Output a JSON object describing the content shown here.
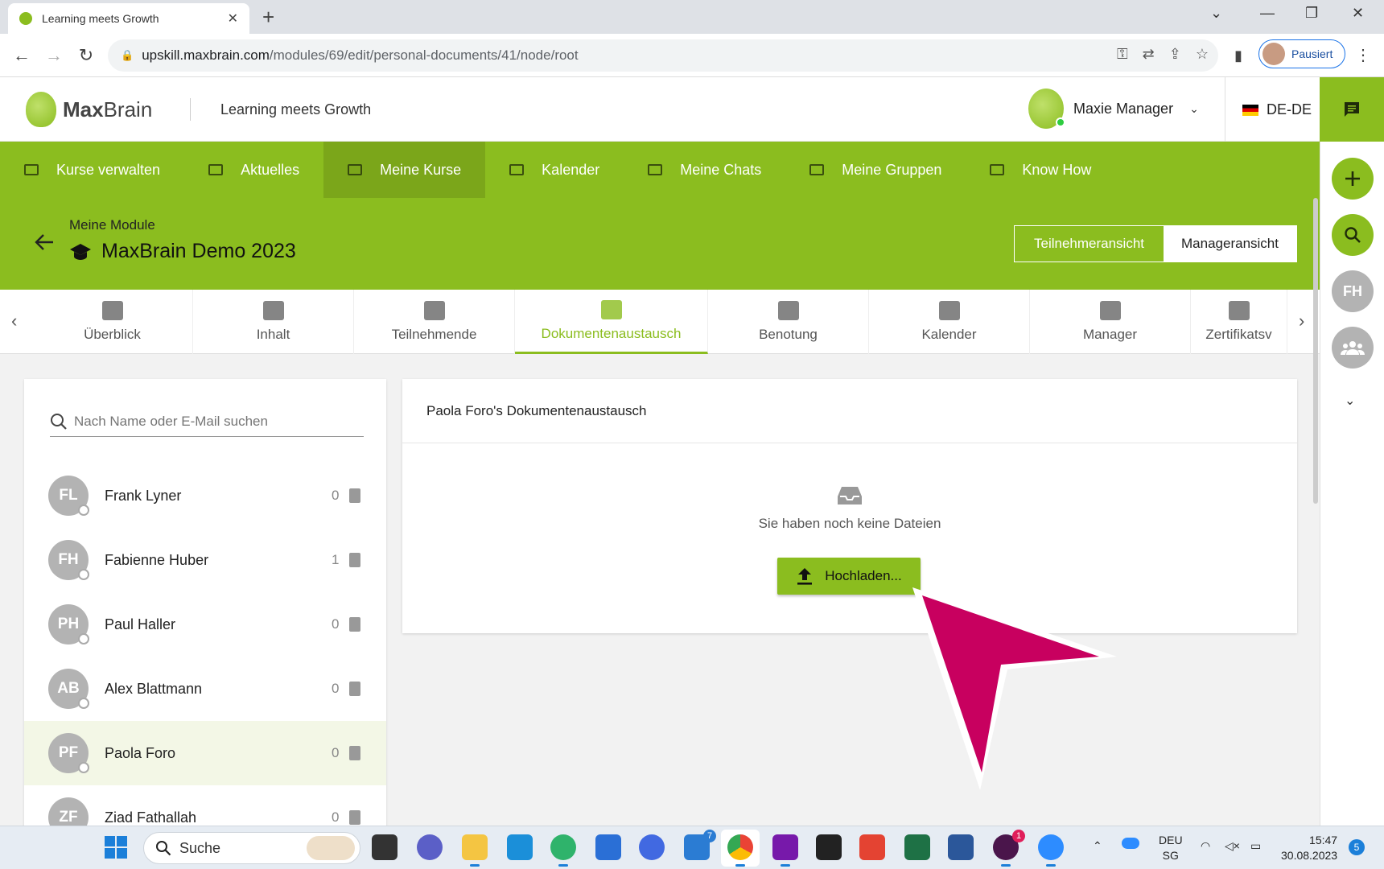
{
  "browser": {
    "tab_title": "Learning meets Growth",
    "url_host": "upskill.maxbrain.com",
    "url_path": "/modules/69/edit/personal-documents/41/node/root",
    "profile_label": "Pausiert"
  },
  "header": {
    "logo_bold": "Max",
    "logo_light": "Brain",
    "tagline": "Learning meets Growth",
    "user_name": "Maxie Manager",
    "language": "DE-DE"
  },
  "main_nav": [
    {
      "label": "Kurse verwalten"
    },
    {
      "label": "Aktuelles"
    },
    {
      "label": "Meine Kurse"
    },
    {
      "label": "Kalender"
    },
    {
      "label": "Meine Chats"
    },
    {
      "label": "Meine Gruppen"
    },
    {
      "label": "Know How"
    }
  ],
  "module": {
    "breadcrumb": "Meine Module",
    "title": "MaxBrain Demo 2023",
    "view_participant": "Teilnehmeransicht",
    "view_manager": "Manageransicht"
  },
  "sub_tabs": [
    {
      "label": "Überblick"
    },
    {
      "label": "Inhalt"
    },
    {
      "label": "Teilnehmende"
    },
    {
      "label": "Dokumentenaustausch"
    },
    {
      "label": "Benotung"
    },
    {
      "label": "Kalender"
    },
    {
      "label": "Manager"
    },
    {
      "label": "Zertifikatsv"
    }
  ],
  "participants": {
    "search_placeholder": "Nach Name oder E-Mail suchen",
    "rows": [
      {
        "initials": "FL",
        "name": "Frank Lyner",
        "count": "0"
      },
      {
        "initials": "FH",
        "name": "Fabienne Huber",
        "count": "1"
      },
      {
        "initials": "PH",
        "name": "Paul Haller",
        "count": "0"
      },
      {
        "initials": "AB",
        "name": "Alex Blattmann",
        "count": "0"
      },
      {
        "initials": "PF",
        "name": "Paola Foro",
        "count": "0"
      },
      {
        "initials": "ZF",
        "name": "Ziad Fathallah",
        "count": "0"
      }
    ]
  },
  "panel": {
    "title": "Paola Foro's Dokumentenaustausch",
    "empty_text": "Sie haben noch keine Dateien",
    "upload_label": "Hochladen..."
  },
  "rail": {
    "user_initials": "FH"
  },
  "taskbar": {
    "search_label": "Suche",
    "lang_1": "DEU",
    "lang_2": "SG",
    "time": "15:47",
    "date": "30.08.2023",
    "notif_count": "5",
    "todo_badge": "7",
    "slack_badge": "1"
  },
  "colors": {
    "brand_green": "#8bbd1f",
    "cursor_pink": "#c8005f"
  }
}
